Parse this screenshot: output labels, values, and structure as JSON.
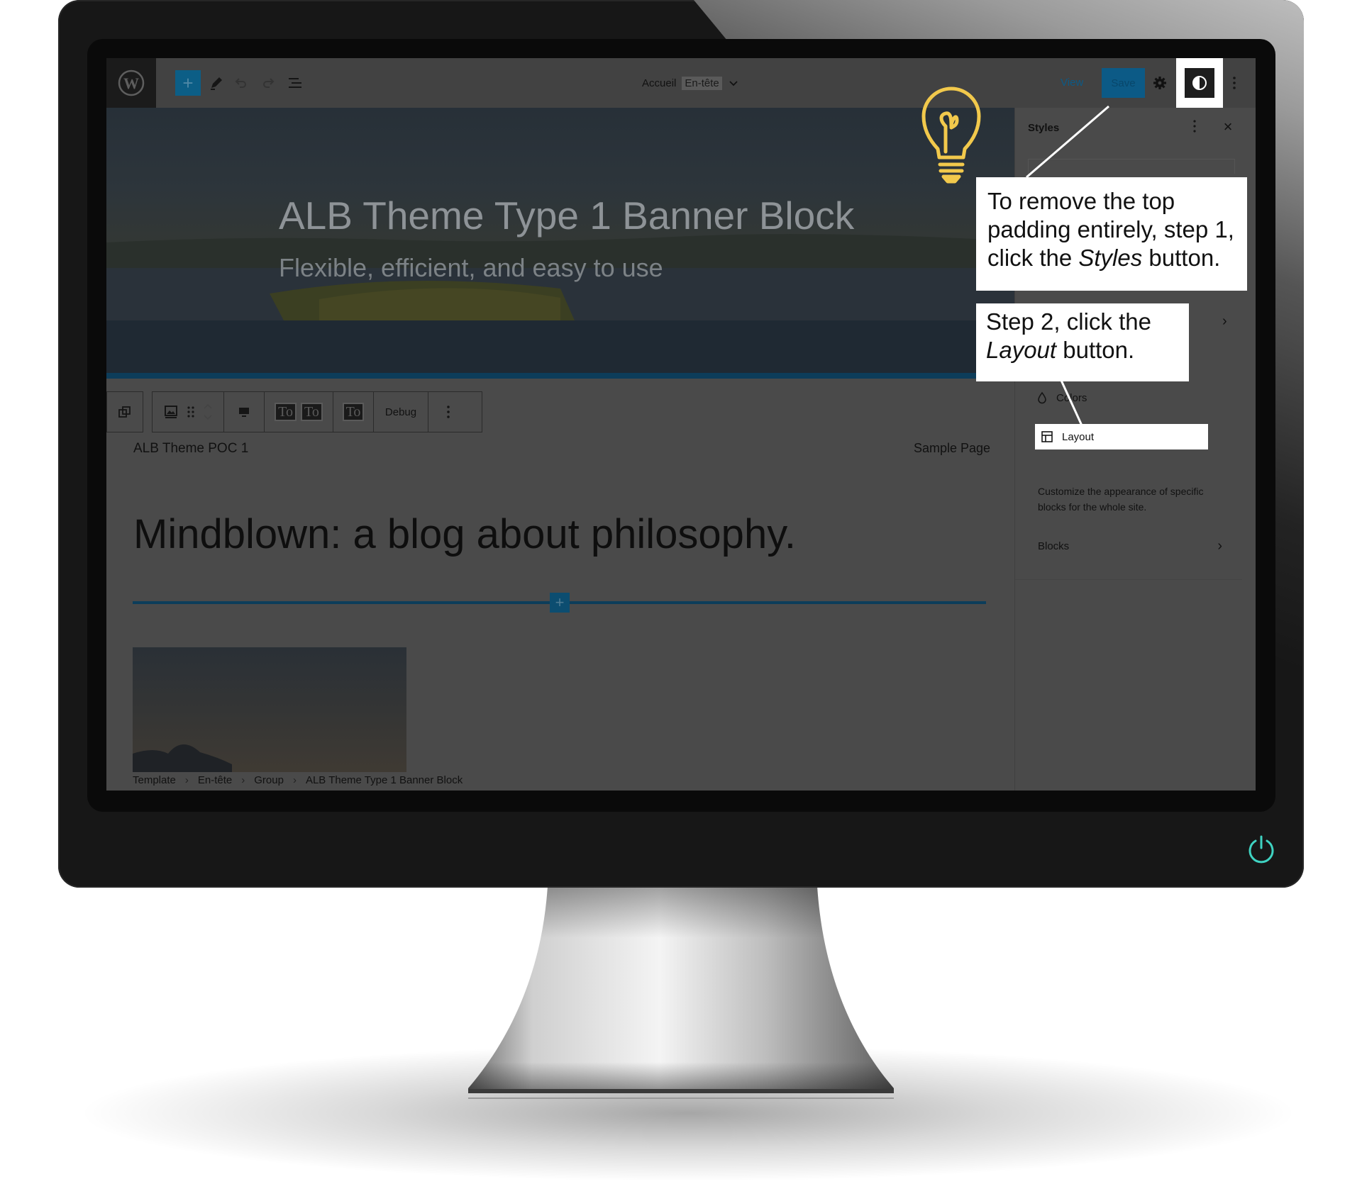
{
  "topbar": {
    "add_label": "+",
    "doc_title": "Accueil",
    "doc_tag": "En-tête",
    "view_label": "View",
    "save_label": "Save"
  },
  "banner": {
    "title": "ALB Theme Type 1 Banner Block",
    "subtitle": "Flexible, efficient, and easy to use"
  },
  "block_toolbar": {
    "debug_label": "Debug",
    "to_icon_glyph": "To"
  },
  "page": {
    "site_title": "ALB Theme POC 1",
    "nav_link": "Sample Page",
    "heading": "Mindblown: a blog about philosophy."
  },
  "breadcrumbs": [
    "Template",
    "En-tête",
    "Group",
    "ALB Theme Type 1 Banner Block"
  ],
  "sidebar": {
    "title": "Styles",
    "colors_label": "Colors",
    "layout_label": "Layout",
    "description": "Customize the appearance of specific blocks for the whole site.",
    "blocks_label": "Blocks"
  },
  "annotations": {
    "step1_a": "To remove the top",
    "step1_b": "padding entirely, step 1,",
    "step1_c_pre": "click the ",
    "step1_c_em": "Styles",
    "step1_c_post": " button.",
    "step2_a": "Step 2, click the",
    "step2_b_em": "Layout",
    "step2_b_post": " button."
  },
  "colors": {
    "accent_blue": "#0c5e86",
    "bulb_yellow": "#f2c94c",
    "power_green": "#3fd3c2"
  },
  "icons": [
    "wordpress-logo-icon",
    "plus-icon",
    "pencil-icon",
    "undo-icon",
    "redo-icon",
    "list-view-icon",
    "chevron-down-icon",
    "gear-icon",
    "contrast-icon",
    "more-vertical-icon",
    "close-icon",
    "droplet-icon",
    "layout-icon",
    "chevron-right-icon",
    "lightbulb-icon",
    "power-icon"
  ]
}
